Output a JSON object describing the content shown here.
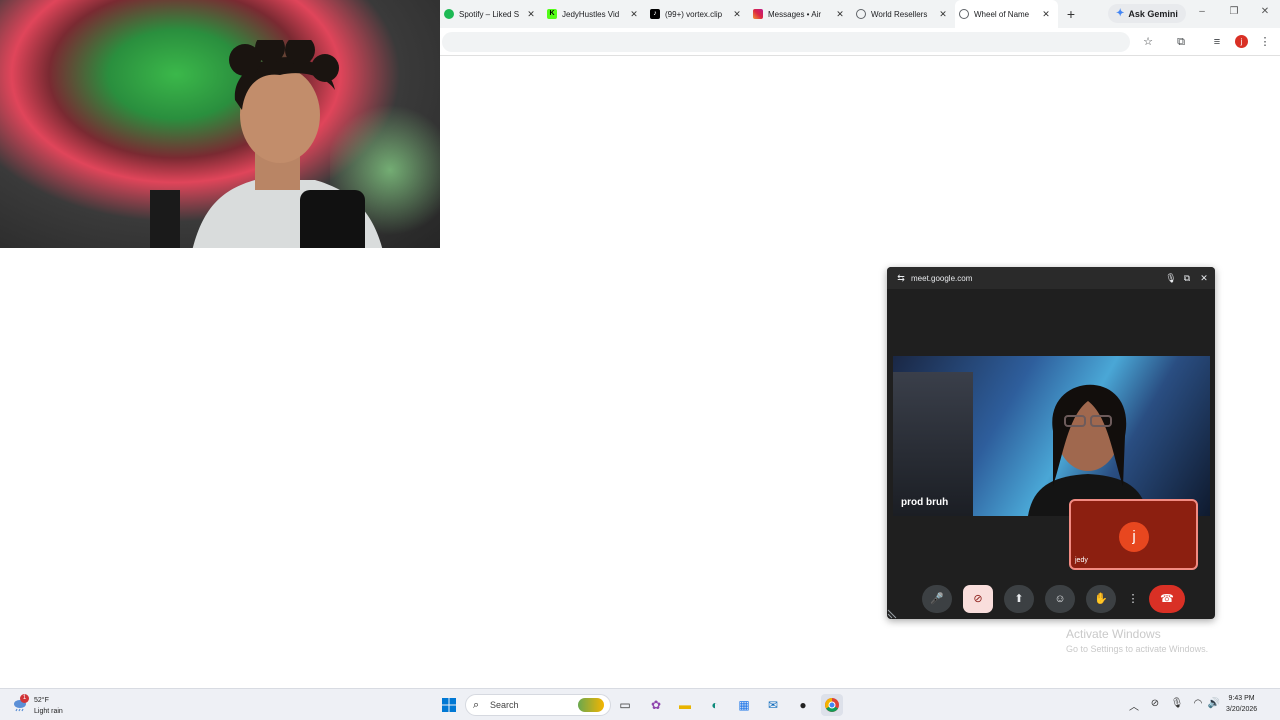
{
  "browser": {
    "tabs": [
      {
        "label": "Spotify – Liked S",
        "icon": "spotify-icon",
        "color": "#1db954"
      },
      {
        "label": "JedyHustles Vid",
        "icon": "kick-icon",
        "color": "#53fc18"
      },
      {
        "label": "(99+) vortex.clip",
        "icon": "tiktok-icon",
        "color": "#000000"
      },
      {
        "label": "Messages • Air",
        "icon": "instagram-icon",
        "color": "#d6249f"
      },
      {
        "label": "World Resellers",
        "icon": "globe-icon",
        "color": "#5f6368"
      },
      {
        "label": "Wheel of Name",
        "icon": "globe-icon",
        "color": "#5f6368",
        "active": true
      }
    ],
    "gemini_label": "Ask Gemini",
    "profile_initial": "j"
  },
  "meet_pip": {
    "url": "meet.google.com",
    "participant_name": "prod bruh",
    "self_initial": "j",
    "self_name": "jedy",
    "accent": "#d93025"
  },
  "watermark": {
    "line1": "Activate Windows",
    "line2": "Go to Settings to activate Windows."
  },
  "taskbar": {
    "weather": {
      "badge": "1",
      "temp": "52°F",
      "condition": "Light rain"
    },
    "search_label": "Search",
    "clock": {
      "time": "9:43 PM",
      "date": "3/20/2026"
    }
  }
}
